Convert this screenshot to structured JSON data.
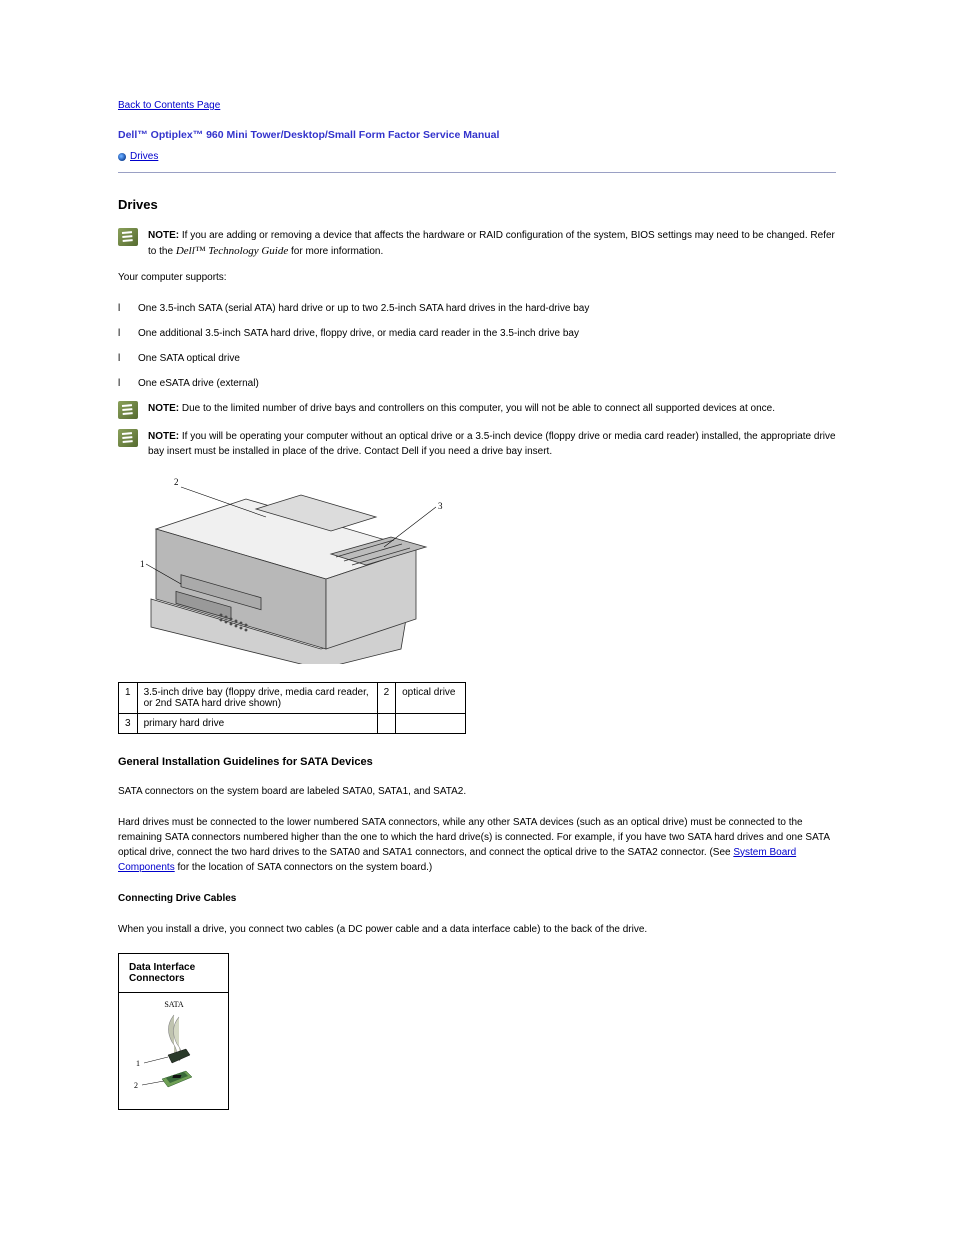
{
  "contents_page_link": "Back to Contents Page",
  "manual_title": "Dell™ Optiplex™ 960 Mini Tower/Desktop/Small Form Factor Service Manual",
  "toc": {
    "drives": "Drives"
  },
  "section_heading": "Drives",
  "note1_prefix": "NOTE:",
  "note1_body": " If you are adding or removing a device that affects the hardware or RAID configuration of the system, BIOS settings may need to be changed. Refer to the ",
  "note1_italic": "Dell™ Technology Guide",
  "note1_after": " for more information.",
  "intro": "Your computer supports:",
  "bullets": {
    "b1": "One 3.5-inch SATA (serial ATA) hard drive or up to two 2.5-inch SATA hard drives in the hard-drive bay",
    "b2": "One additional 3.5-inch SATA hard drive, floppy drive, or media card reader in the 3.5-inch drive bay",
    "b3": "One SATA optical drive",
    "b4": "One eSATA drive (external)"
  },
  "note2_prefix": "NOTE:",
  "note2_body": " Due to the limited number of drive bays and controllers on this computer, you will not be able to connect all supported devices at once.",
  "note3_prefix": "NOTE:",
  "note3_body": " If you will be operating your computer without an optical drive or a 3.5-inch device (floppy drive or media card reader) installed, the appropriate drive bay insert must be installed in place of the drive. Contact Dell if you need a drive bay insert.",
  "callouts": {
    "c1_num": "1",
    "c1_text": "3.5-inch drive bay (floppy drive, media card reader, or 2nd SATA hard drive shown)",
    "c2_num": "2",
    "c2_text": "optical drive",
    "c3_num": "3",
    "c3_text": "primary hard drive"
  },
  "sub_heading": "General Installation Guidelines for SATA Devices",
  "sub_para": "SATA connectors on the system board are labeled SATA0, SATA1, and SATA2.",
  "sub_para2a": "Hard drives must be connected to the lower numbered SATA connectors, while any other SATA devices (such as an optical drive) must be connected to the remaining SATA connectors numbered higher than the one to which the hard drive(s) is connected. For example, if you have two SATA hard drives and one SATA optical drive, connect the two hard drives to the SATA0 and SATA1 connectors, and connect the optical drive to the SATA2 connector. (See ",
  "sub_para2_link": "System Board Components",
  "sub_para2b": " for the location of SATA connectors on the system board.)",
  "cables_heading": "Connecting Drive Cables",
  "cables_body": "When you install a drive, you connect two cables (a DC power cable and a data interface cable) to the back of the drive.",
  "cable_table_caption": "Data Interface Connectors",
  "sata_label": "SATA",
  "diagram_label_1": "1",
  "diagram_label_2": "2"
}
